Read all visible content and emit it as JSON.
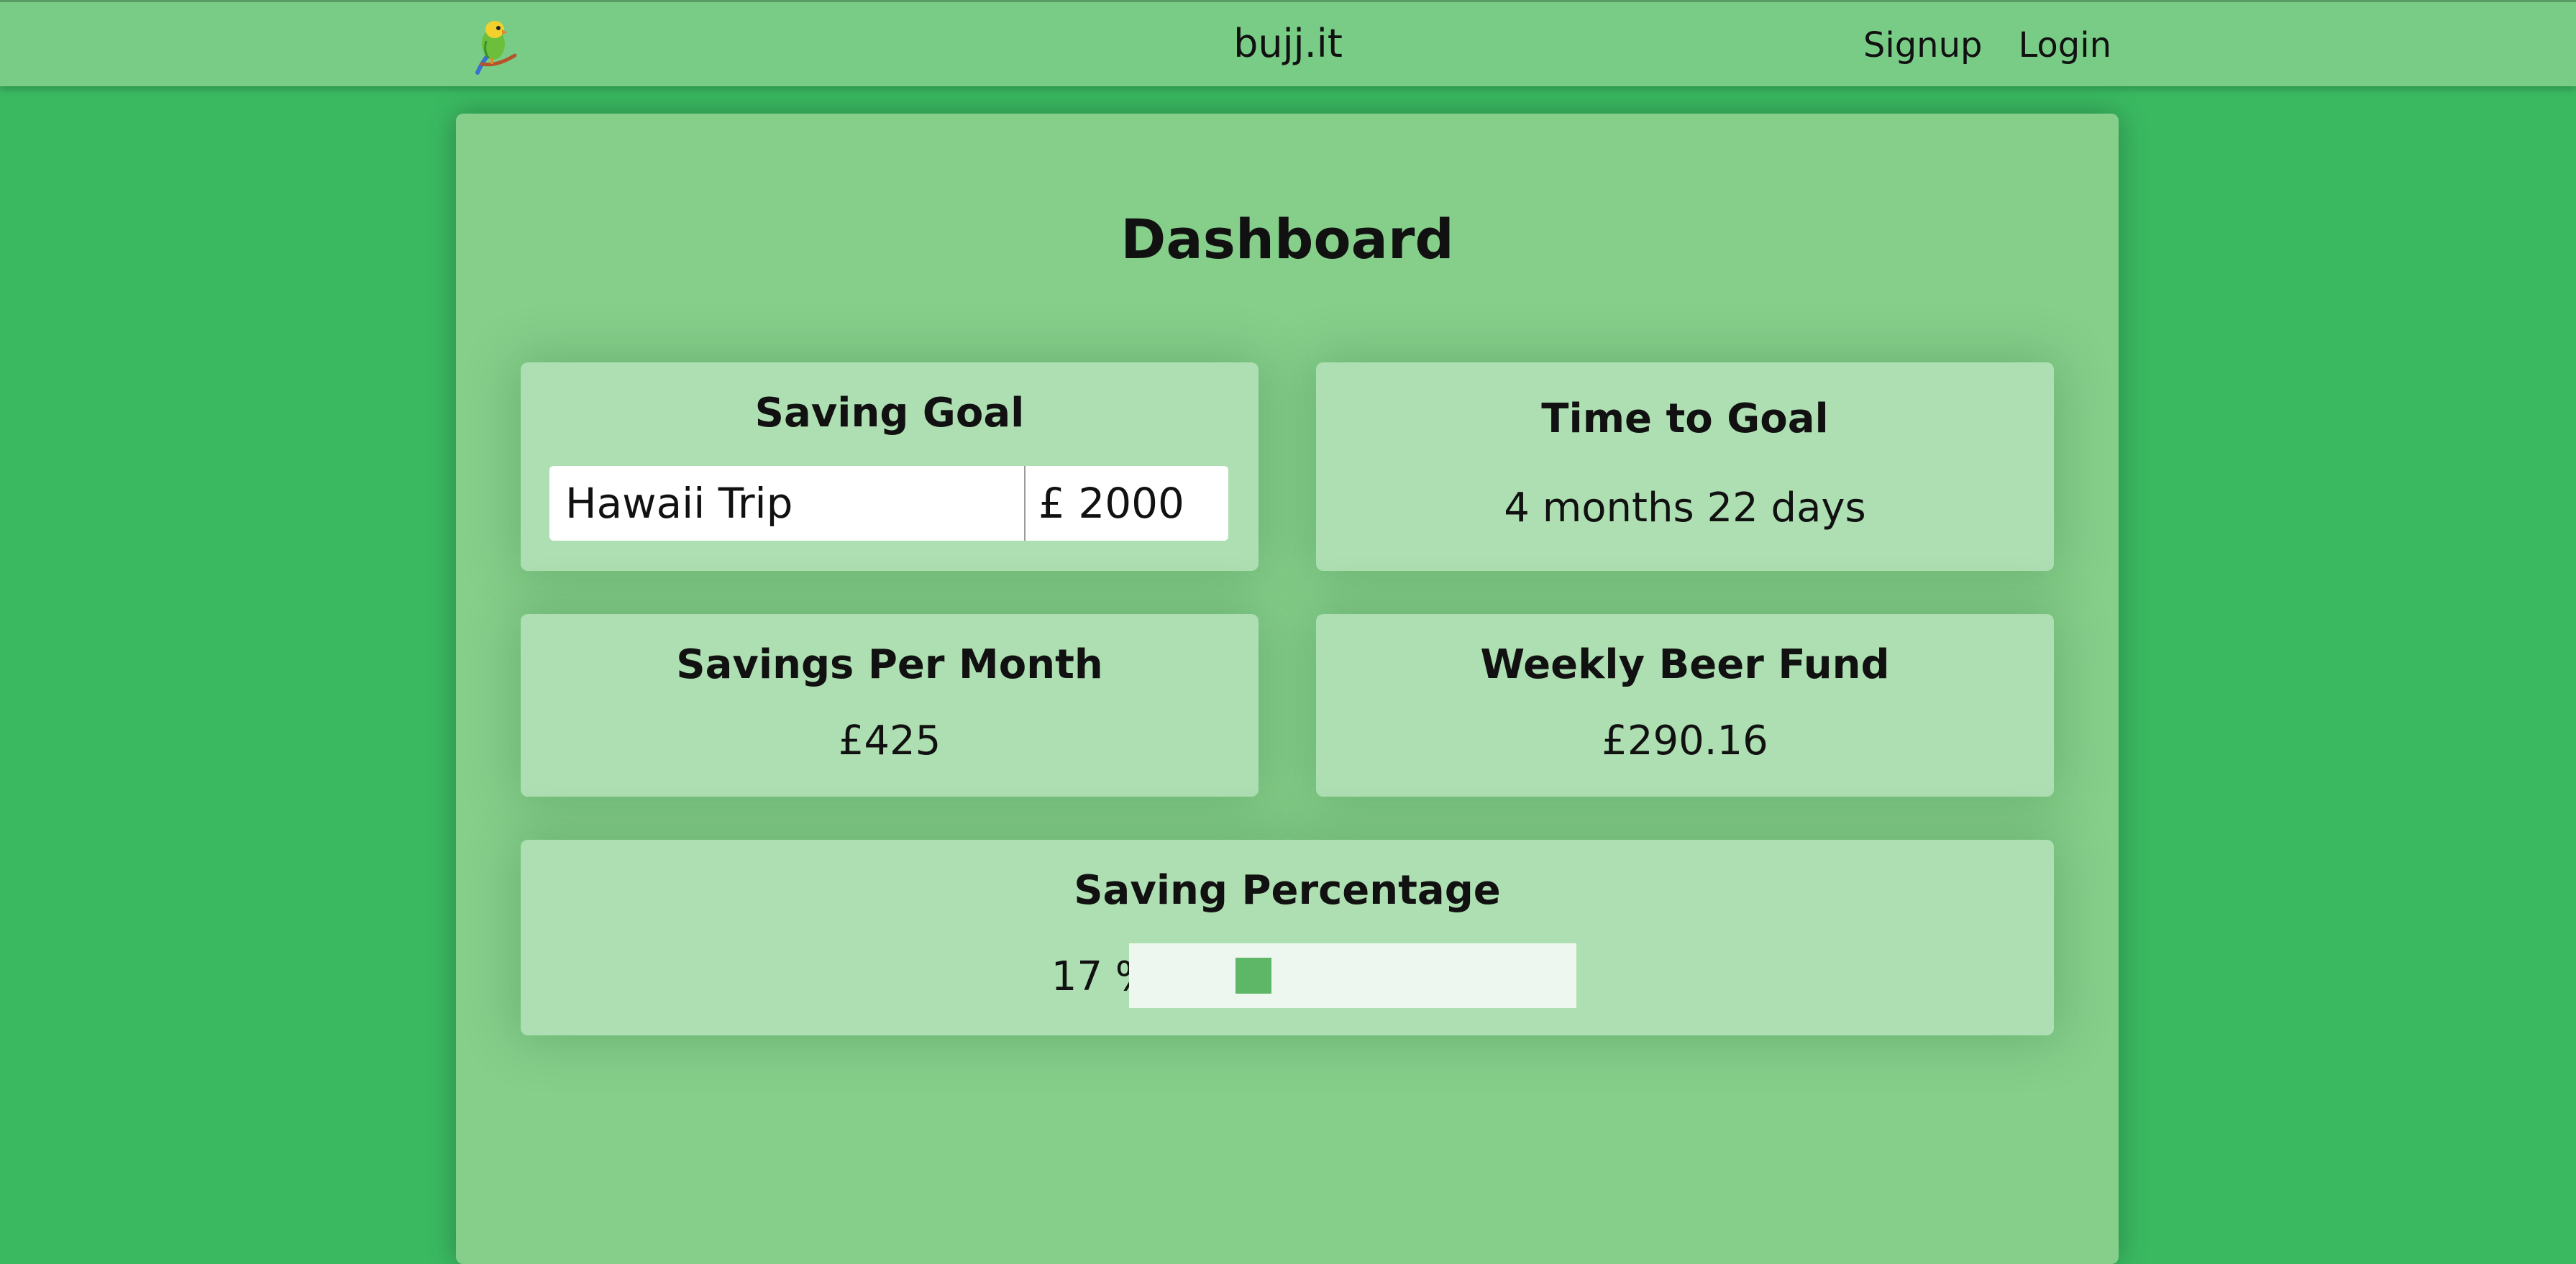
{
  "navbar": {
    "brand": "bujj.it",
    "logo_icon": "parrot-icon",
    "links": [
      "Signup",
      "Login"
    ]
  },
  "dashboard": {
    "title": "Dashboard",
    "saving_goal": {
      "title": "Saving Goal",
      "goal_name": "Hawaii Trip",
      "currency_symbol": "£",
      "goal_amount": "2000"
    },
    "time_to_goal": {
      "title": "Time to Goal",
      "value": "4 months 22 days"
    },
    "savings_per_month": {
      "title": "Savings Per Month",
      "value": "£425"
    },
    "weekly_beer_fund": {
      "title": "Weekly Beer Fund",
      "value": "£290.16"
    },
    "saving_percentage": {
      "title": "Saving Percentage",
      "label": "17 %",
      "value": 17
    }
  },
  "colors": {
    "background": "#3ab961",
    "navbar": "#79cc86",
    "panel": "#86cf8b",
    "card": "#aedfb2",
    "progress_fill": "#5db766"
  }
}
